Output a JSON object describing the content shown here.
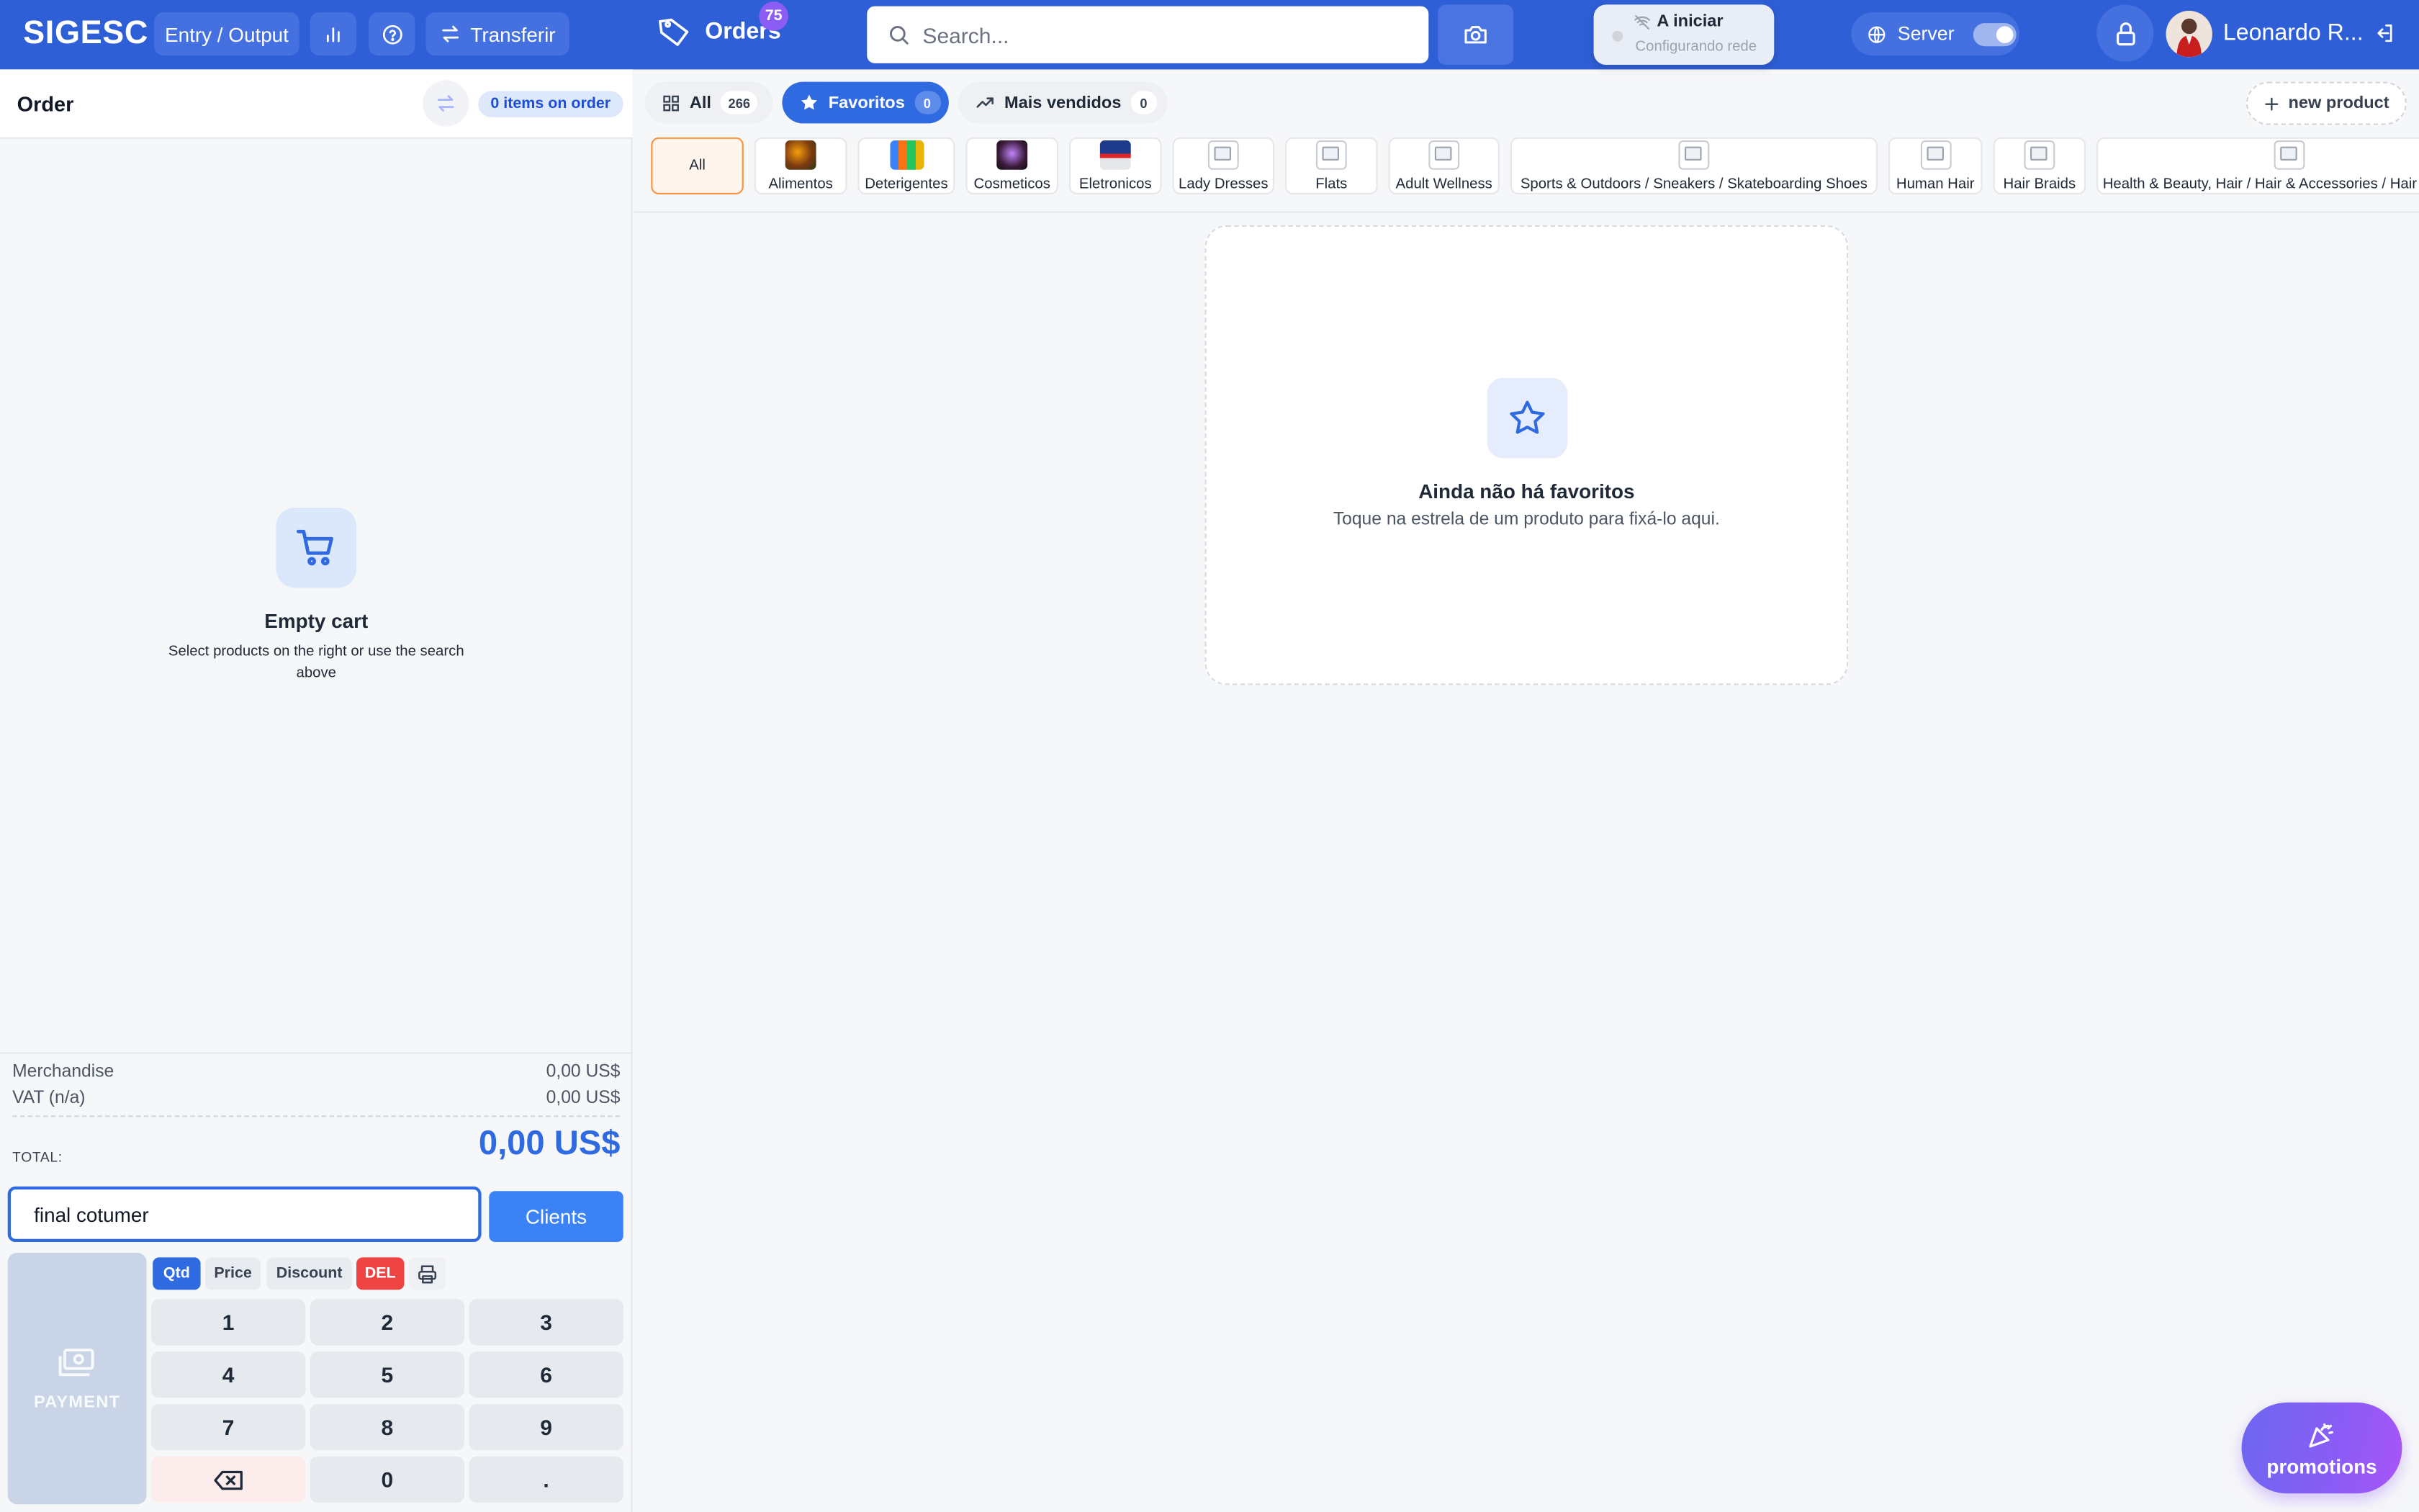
{
  "header": {
    "brand": "SIGESC",
    "entry_output_label": "Entry / Output",
    "transfer_label": "Transferir",
    "orders_label": "Orders",
    "orders_count": "75",
    "search_placeholder": "Search...",
    "network_status": "A iniciar",
    "network_substatus": "Configurando rede",
    "server_label": "Server",
    "server_enabled": true,
    "user_name": "Leonardo R..."
  },
  "order": {
    "title": "Order",
    "items_badge": "0 items on order",
    "empty_title": "Empty cart",
    "empty_subtitle": "Select products on the right or use the search above",
    "merchandise_label": "Merchandise",
    "merchandise_value": "0,00 US$",
    "vat_label": "VAT (n/a)",
    "vat_value": "0,00 US$",
    "total_label": "TOTAL:",
    "total_value": "0,00 US$",
    "client_value": "final cotumer",
    "clients_button": "Clients",
    "payment_label": "PAYMENT",
    "modes": [
      "Qtd",
      "Price",
      "Discount",
      "DEL"
    ],
    "keypad": [
      "1",
      "2",
      "3",
      "4",
      "5",
      "6",
      "7",
      "8",
      "9",
      "⌫",
      "0",
      "."
    ]
  },
  "tabs": [
    {
      "label": "All",
      "count": "266"
    },
    {
      "label": "Favoritos",
      "count": "0"
    },
    {
      "label": "Mais vendidos",
      "count": "0"
    }
  ],
  "new_product_label": "new product",
  "categories": [
    {
      "label": "All"
    },
    {
      "label": "Alimentos"
    },
    {
      "label": "Deterigentes"
    },
    {
      "label": "Cosmeticos"
    },
    {
      "label": "Eletronicos"
    },
    {
      "label": "Lady Dresses"
    },
    {
      "label": "Flats"
    },
    {
      "label": "Adult Wellness"
    },
    {
      "label": "Sports & Outdoors / Sneakers / Skateboarding Shoes"
    },
    {
      "label": "Human Hair"
    },
    {
      "label": "Hair Braids"
    },
    {
      "label": "Health & Beauty, Hair / Hair & Accessories / Hair"
    }
  ],
  "favorites": {
    "empty_title": "Ainda não há favoritos",
    "empty_subtitle": "Toque na estrela de um produto para fixá-lo aqui."
  },
  "promotions_label": "promotions",
  "colors": {
    "header_bg": "#2f5fd7",
    "accent": "#2f6ae0",
    "delete_red": "#ef4444",
    "promo_purple": "#8b5cf6",
    "all_category_orange": "#fb923c"
  }
}
